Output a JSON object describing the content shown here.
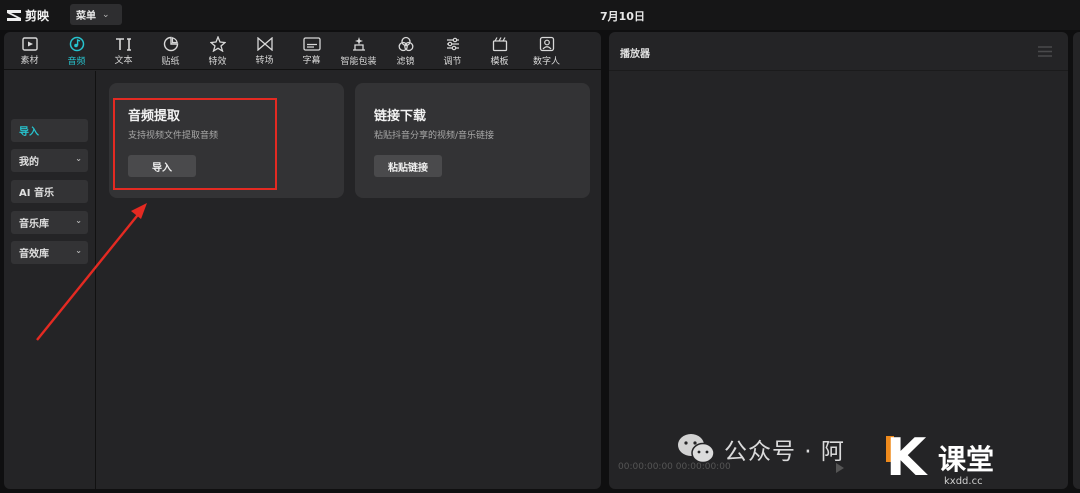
{
  "app": {
    "name": "剪映",
    "menu_label": "菜单",
    "date": "7月10日"
  },
  "toolbar": {
    "items": [
      {
        "label": "素材",
        "icon": "media-icon"
      },
      {
        "label": "音频",
        "icon": "audio-icon",
        "active": true
      },
      {
        "label": "文本",
        "icon": "text-icon"
      },
      {
        "label": "贴纸",
        "icon": "sticker-icon"
      },
      {
        "label": "特效",
        "icon": "effects-icon"
      },
      {
        "label": "转场",
        "icon": "transition-icon"
      },
      {
        "label": "字幕",
        "icon": "subtitle-icon"
      },
      {
        "label": "智能包装",
        "icon": "smart-pack-icon"
      },
      {
        "label": "滤镜",
        "icon": "filter-icon"
      },
      {
        "label": "调节",
        "icon": "adjust-icon"
      },
      {
        "label": "模板",
        "icon": "template-icon"
      },
      {
        "label": "数字人",
        "icon": "digital-human-icon"
      }
    ]
  },
  "sidebar": {
    "items": [
      {
        "label": "导入",
        "active": true
      },
      {
        "label": "我的",
        "has_chevron": true
      },
      {
        "label": "AI 音乐"
      },
      {
        "label": "音乐库",
        "has_chevron": true
      },
      {
        "label": "音效库",
        "has_chevron": true
      }
    ]
  },
  "cards": [
    {
      "title": "音频提取",
      "desc": "支持视频文件提取音频",
      "button": "导入"
    },
    {
      "title": "链接下载",
      "desc": "粘贴抖音分享的视频/音乐链接",
      "button": "粘贴链接"
    }
  ],
  "player": {
    "title": "播放器",
    "timecode": "00:00:00:00  00:00:00:00"
  },
  "watermark": {
    "text": "公众号 · 阿",
    "brand_main": "课堂",
    "brand_domain": "kxdd.cc"
  },
  "colors": {
    "accent": "#27c4cf",
    "highlight": "#e42a22",
    "panel": "#242426",
    "card": "#333335"
  }
}
